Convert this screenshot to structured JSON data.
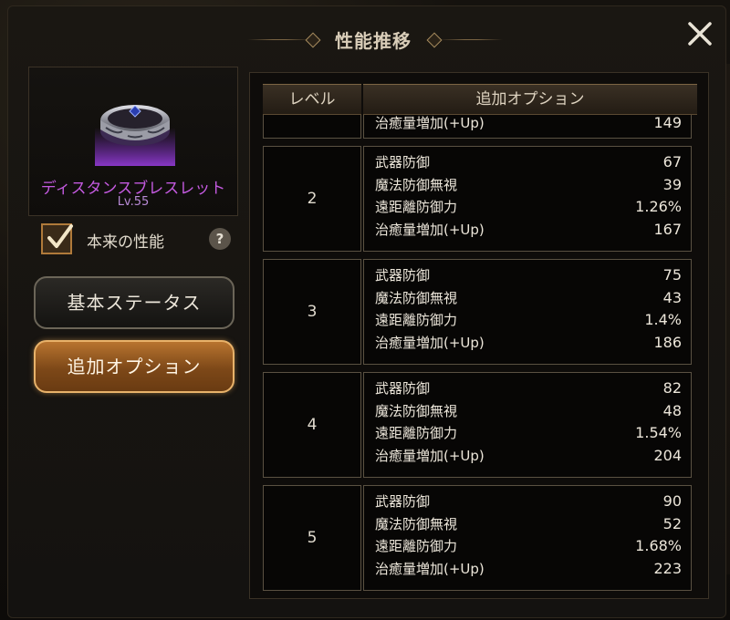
{
  "title": "性能推移",
  "item": {
    "name": "ディスタンスブレスレット",
    "level": "Lv.55"
  },
  "original_perf": {
    "label": "本来の性能",
    "checked": true,
    "help": "?"
  },
  "buttons": {
    "basic": "基本ステータス",
    "extra": "追加オプション"
  },
  "table": {
    "headers": {
      "level": "レベル",
      "option": "追加オプション"
    },
    "partial_row": {
      "name": "治癒量増加(+Up)",
      "value": "149"
    },
    "rows": [
      {
        "level": "2",
        "options": [
          {
            "name": "武器防御",
            "value": "67"
          },
          {
            "name": "魔法防御無視",
            "value": "39"
          },
          {
            "name": "遠距離防御力",
            "value": "1.26%"
          },
          {
            "name": "治癒量増加(+Up)",
            "value": "167"
          }
        ]
      },
      {
        "level": "3",
        "options": [
          {
            "name": "武器防御",
            "value": "75"
          },
          {
            "name": "魔法防御無視",
            "value": "43"
          },
          {
            "name": "遠距離防御力",
            "value": "1.4%"
          },
          {
            "name": "治癒量増加(+Up)",
            "value": "186"
          }
        ]
      },
      {
        "level": "4",
        "options": [
          {
            "name": "武器防御",
            "value": "82"
          },
          {
            "name": "魔法防御無視",
            "value": "48"
          },
          {
            "name": "遠距離防御力",
            "value": "1.54%"
          },
          {
            "name": "治癒量増加(+Up)",
            "value": "204"
          }
        ]
      },
      {
        "level": "5",
        "options": [
          {
            "name": "武器防御",
            "value": "90"
          },
          {
            "name": "魔法防御無視",
            "value": "52"
          },
          {
            "name": "遠距離防御力",
            "value": "1.68%"
          },
          {
            "name": "治癒量増加(+Up)",
            "value": "223"
          }
        ]
      }
    ]
  },
  "colors": {
    "item_name": "#c45ae0",
    "accent_gold": "#e8b26a",
    "checkbox": "#b07a3a"
  }
}
